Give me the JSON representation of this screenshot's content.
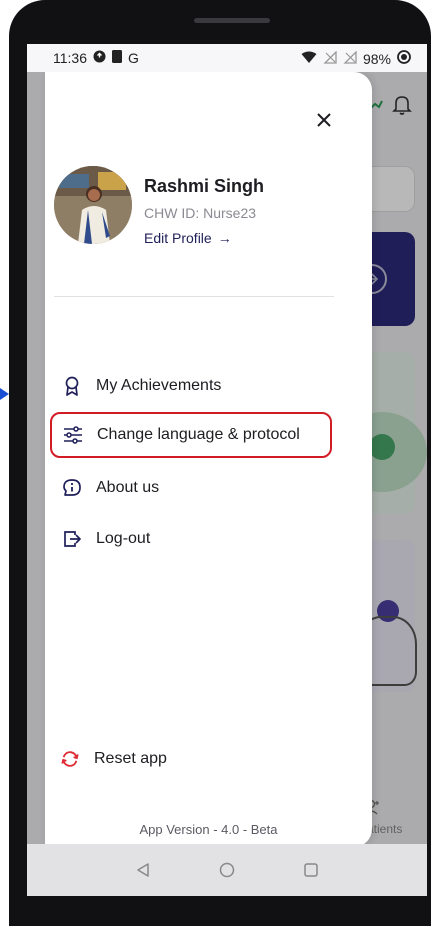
{
  "status_bar": {
    "time": "11:36",
    "left_letter": "G",
    "battery": "98%"
  },
  "drawer": {
    "profile": {
      "name": "Rashmi Singh",
      "id": "CHW ID: Nurse23",
      "edit_label": "Edit Profile",
      "edit_arrow": "→"
    },
    "menu_items": [
      {
        "label": "My Achievements",
        "icon": "award-icon"
      },
      {
        "label": "Change language & protocol",
        "icon": "sliders-icon"
      },
      {
        "label": "About us",
        "icon": "info-icon"
      },
      {
        "label": "Log-out",
        "icon": "logout-icon"
      }
    ],
    "reset_label": "Reset app",
    "version": "App Version - 4.0 - Beta"
  },
  "background_app": {
    "partial_label": "l Patients"
  },
  "colors": {
    "highlight": "#d21b24",
    "reset_icon": "#e02a33",
    "pointer": "#1b4fd3",
    "primary_dark": "#1f1f5a"
  }
}
